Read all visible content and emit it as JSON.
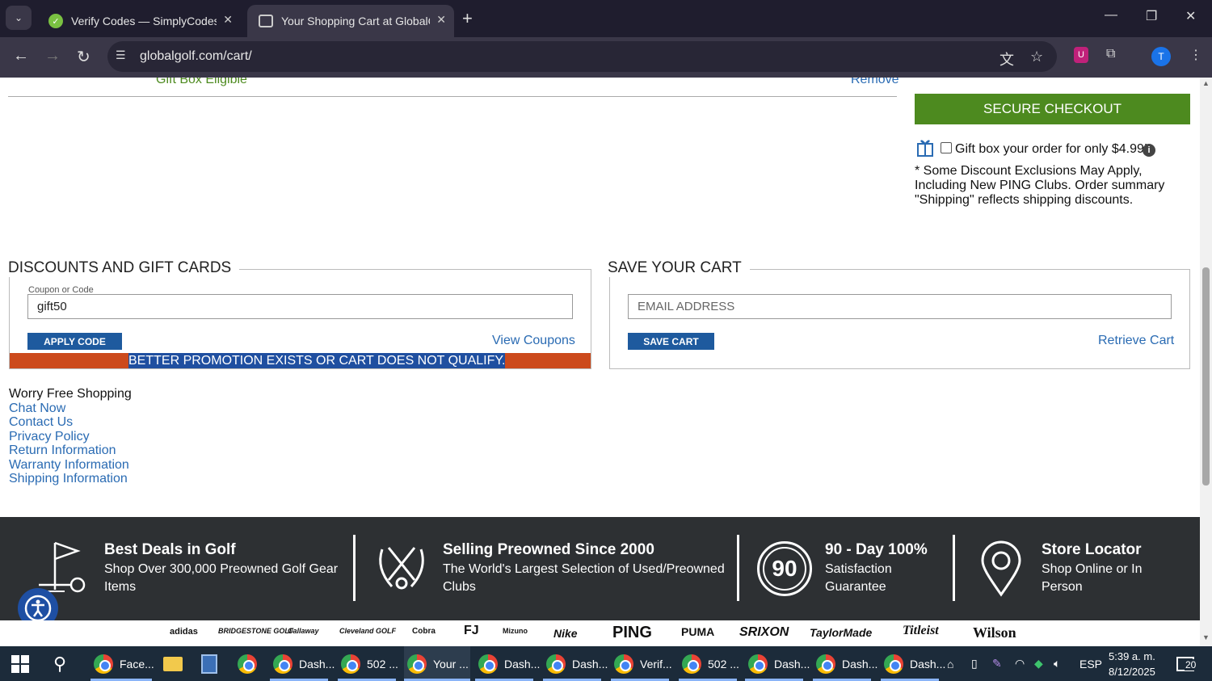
{
  "browser": {
    "tabs": [
      {
        "title": "Verify Codes — SimplyCodes",
        "active": false
      },
      {
        "title": "Your Shopping Cart at GlobalGolf",
        "active": true
      }
    ],
    "url": "globalgolf.com/cart/",
    "profile_initial": "T"
  },
  "cart_item": {
    "gift_box_eligible": "Gift Box Eligible",
    "remove": "Remove"
  },
  "checkout": {
    "secure_checkout": "SECURE CHECKOUT",
    "gift_box_label": "Gift box your order for only $4.99!",
    "info": "i",
    "disclaimer": "* Some Discount Exclusions May Apply, Including New PING Clubs. Order summary \"Shipping\" reflects shipping discounts."
  },
  "discounts": {
    "heading": "DISCOUNTS AND GIFT CARDS",
    "field_label": "Coupon or Code",
    "code_value": "gift50",
    "apply_button": "APPLY CODE",
    "view_coupons": "View Coupons",
    "message": "BETTER PROMOTION EXISTS OR CART DOES NOT QUALIFY."
  },
  "save_cart": {
    "heading": "SAVE YOUR CART",
    "email_placeholder": "EMAIL ADDRESS",
    "save_button": "SAVE CART",
    "retrieve": "Retrieve Cart"
  },
  "footer": {
    "heading": "Worry Free Shopping",
    "links": [
      "Chat Now",
      "Contact Us",
      "Privacy Policy",
      "Return Information",
      "Warranty Information",
      "Shipping Information"
    ]
  },
  "features": [
    {
      "title": "Best Deals in Golf",
      "desc": "Shop Over 300,000 Preowned Golf Gear Items"
    },
    {
      "title": "Selling Preowned Since 2000",
      "desc": "The World's Largest Selection of Used/Preowned Clubs"
    },
    {
      "title": "90 - Day 100%",
      "desc": "Satisfaction Guarantee",
      "badge": "90"
    },
    {
      "title": "Store Locator",
      "desc": "Shop Online or In Person"
    }
  ],
  "brands": [
    "adidas",
    "BRIDGESTONE GOLF",
    "Callaway",
    "Cleveland GOLF",
    "Cobra",
    "FJ",
    "Mizuno",
    "Nike",
    "PING",
    "PUMA",
    "SRIXON",
    "TaylorMade",
    "Titleist",
    "Wilson"
  ],
  "taskbar": {
    "items": [
      "Face...",
      "",
      "",
      "",
      "Dash...",
      "502 ...",
      "Your ...",
      "Dash...",
      "Dash...",
      "Verif...",
      "502 ...",
      "Dash...",
      "Dash...",
      "Dash..."
    ],
    "language": "ESP",
    "time": "5:39 a. m.",
    "date": "8/12/2025",
    "notifications": "20"
  }
}
